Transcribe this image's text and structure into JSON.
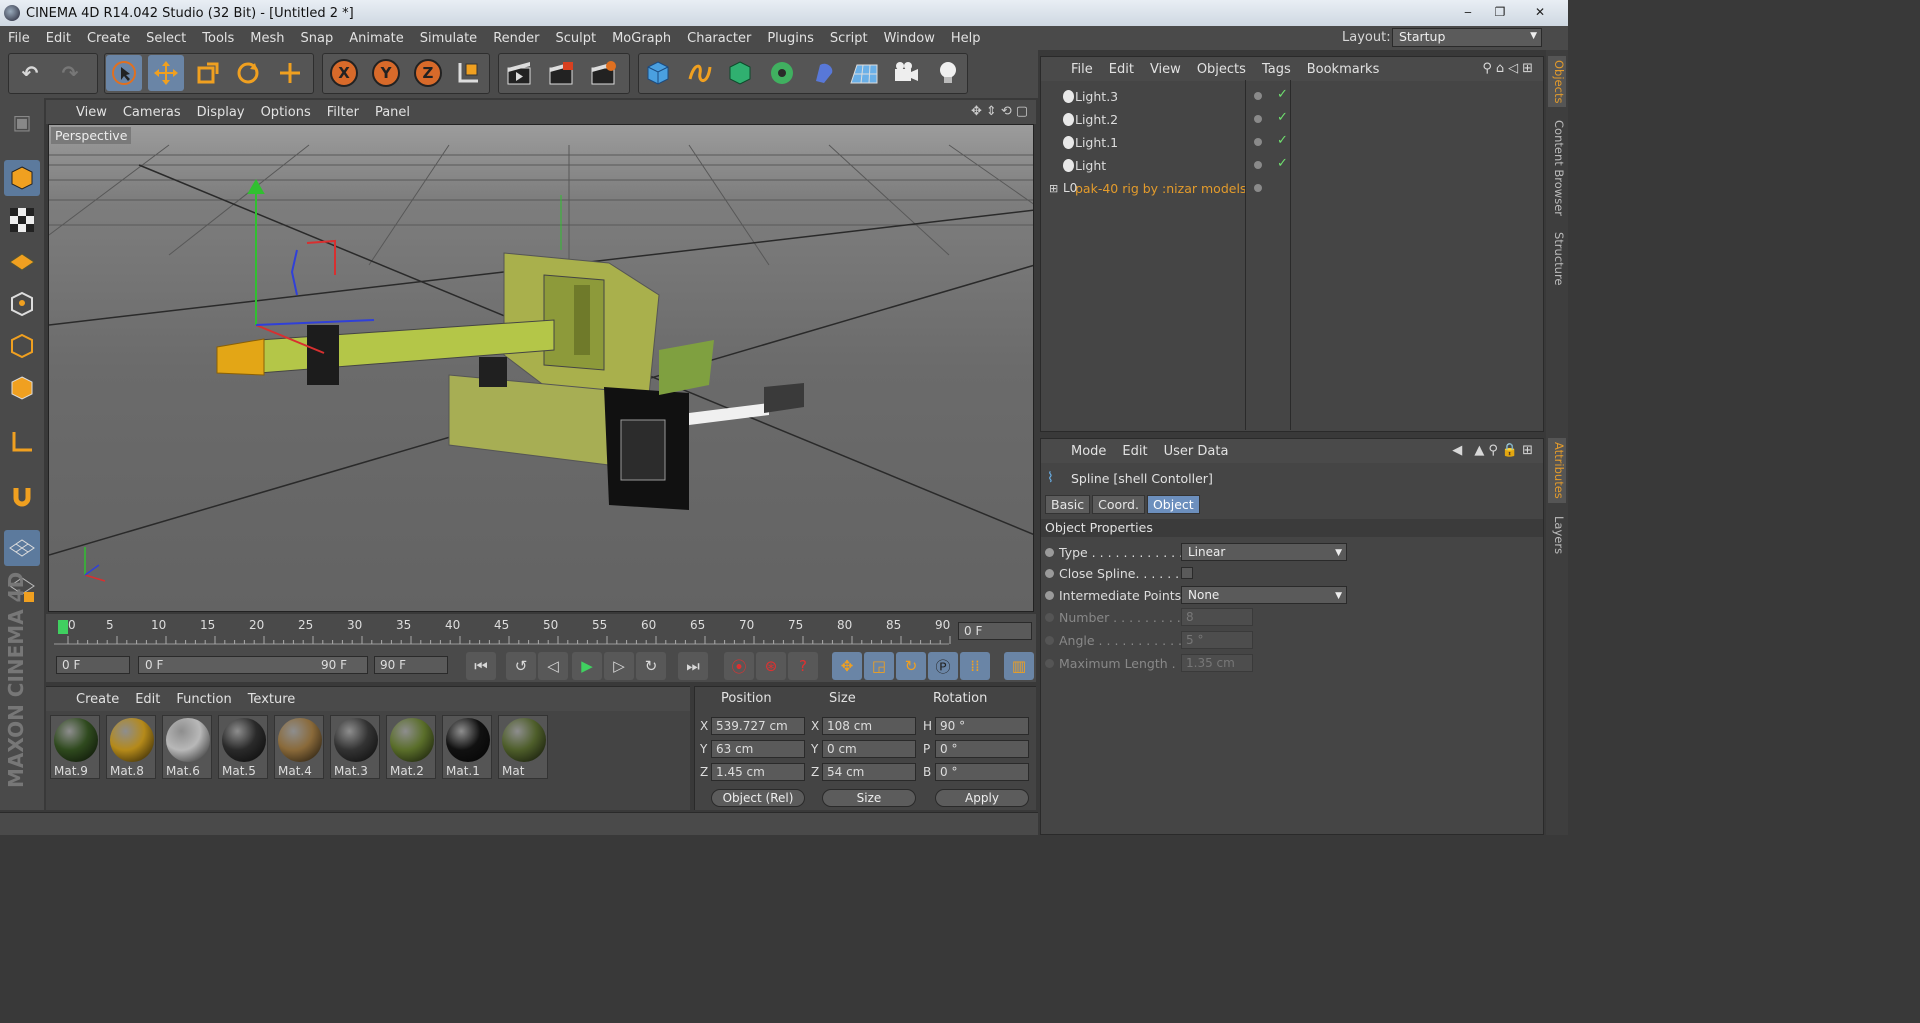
{
  "window": {
    "title": "CINEMA 4D R14.042 Studio (32 Bit) - [Untitled 2 *]"
  },
  "menubar": [
    "File",
    "Edit",
    "Create",
    "Select",
    "Tools",
    "Mesh",
    "Snap",
    "Animate",
    "Simulate",
    "Render",
    "Sculpt",
    "MoGraph",
    "Character",
    "Plugins",
    "Script",
    "Window",
    "Help"
  ],
  "layout": {
    "label": "Layout:",
    "value": "Startup"
  },
  "toolbar": {
    "axis_x": "X",
    "axis_y": "Y",
    "axis_z": "Z"
  },
  "viewport": {
    "menu": [
      "View",
      "Cameras",
      "Display",
      "Options",
      "Filter",
      "Panel"
    ],
    "label": "Perspective"
  },
  "timeline": {
    "ticks": [
      "0",
      "5",
      "10",
      "15",
      "20",
      "25",
      "30",
      "35",
      "40",
      "45",
      "50",
      "55",
      "60",
      "65",
      "70",
      "75",
      "80",
      "85",
      "90"
    ],
    "current_frame": "0 F"
  },
  "transport": {
    "start": "0 F",
    "range_start": "0 F",
    "range_end": "90 F",
    "end": "90 F"
  },
  "materials": {
    "menu": [
      "Create",
      "Edit",
      "Function",
      "Texture"
    ],
    "items": [
      {
        "name": "Mat.9",
        "color": "#2f4a1e"
      },
      {
        "name": "Mat.8",
        "color": "#b58a1a"
      },
      {
        "name": "Mat.6",
        "color": "#b8b8b8"
      },
      {
        "name": "Mat.5",
        "color": "#2a2a2a"
      },
      {
        "name": "Mat.4",
        "color": "#8a6a3a"
      },
      {
        "name": "Mat.3",
        "color": "#333333"
      },
      {
        "name": "Mat.2",
        "color": "#5a6e2a"
      },
      {
        "name": "Mat.1",
        "color": "#111111"
      },
      {
        "name": "Mat",
        "color": "#4e5e2a"
      }
    ]
  },
  "coords": {
    "headers": [
      "Position",
      "Size",
      "Rotation"
    ],
    "pos": {
      "x": "539.727 cm",
      "y": "63 cm",
      "z": "1.45 cm"
    },
    "size": {
      "x": "108 cm",
      "y": "0 cm",
      "z": "54 cm"
    },
    "rot": {
      "h": "90 °",
      "p": "0 °",
      "b": "0 °"
    },
    "mode": "Object (Rel)",
    "size_mode": "Size",
    "apply": "Apply"
  },
  "object_manager": {
    "menu": [
      "File",
      "Edit",
      "View",
      "Objects",
      "Tags",
      "Bookmarks"
    ],
    "objects": [
      {
        "name": "Light.3"
      },
      {
        "name": "Light.2"
      },
      {
        "name": "Light.1"
      },
      {
        "name": "Light"
      },
      {
        "name": "pak-40 rig by :nizar models"
      }
    ]
  },
  "attributes": {
    "menu": [
      "Mode",
      "Edit",
      "User Data"
    ],
    "object": "Spline [shell Contoller]",
    "tabs": [
      "Basic",
      "Coord.",
      "Object"
    ],
    "section": "Object Properties",
    "props": {
      "type_label": "Type . . . . . . . . . . . .",
      "type_value": "Linear",
      "close_label": "Close Spline. . . . . .",
      "inter_label": "Intermediate Points",
      "inter_value": "None",
      "number_label": "Number . . . . . . . . .",
      "number_value": "8",
      "angle_label": "Angle . . . . . . . . . . .",
      "angle_value": "5 °",
      "maxlen_label": "Maximum Length .",
      "maxlen_value": "1.35 cm"
    }
  },
  "side_tabs": [
    "Objects",
    "Content Browser",
    "Structure",
    "Attributes",
    "Layers"
  ],
  "brand": "MAXON CINEMA 4D"
}
